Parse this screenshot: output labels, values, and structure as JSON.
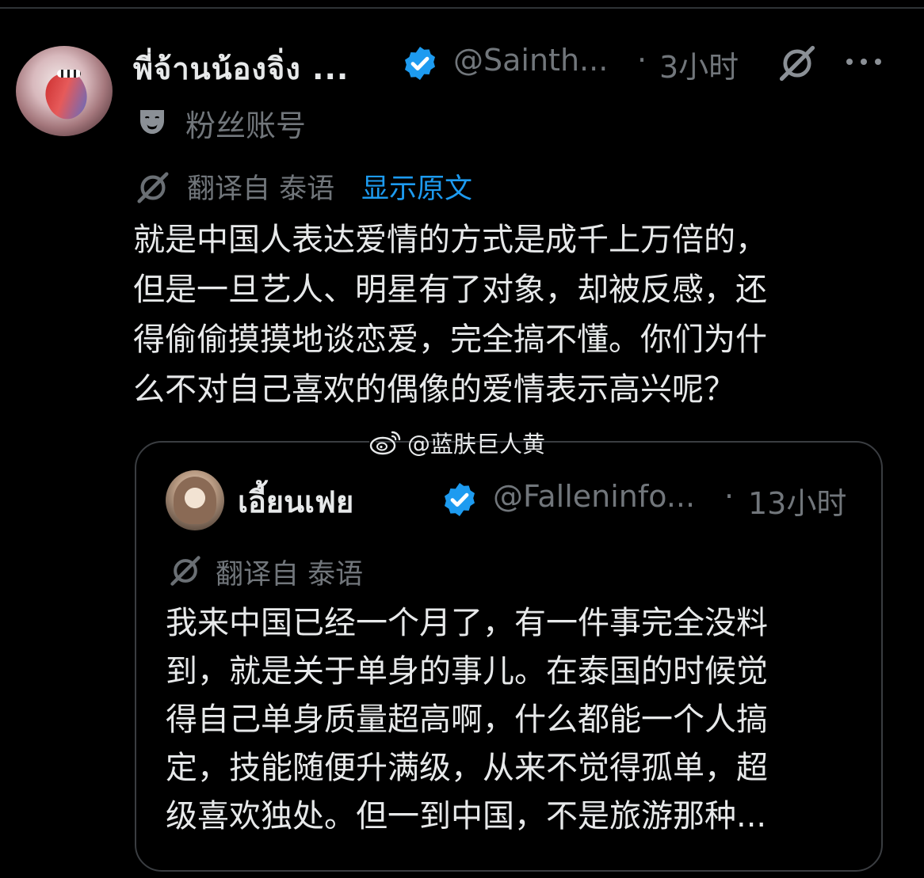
{
  "tweet": {
    "display_name": "พี่จ้านน้องจิ่ง ...",
    "handle": "@Sainth...",
    "separator": "·",
    "time": "3小时",
    "account_label": "粉丝账号",
    "translated_from": "翻译自 泰语",
    "show_original": "显示原文",
    "body": "就是中国人表达爱情的方式是成千上万倍的，\n但是一旦艺人、明星有了对象，却被反感，还\n得偷偷摸摸地谈恋爱，完全搞不懂。你们为什\n么不对自己喜欢的偶像的爱情表示高兴呢？"
  },
  "watermark": {
    "text": "@蓝肤巨人黄"
  },
  "quoted_tweet": {
    "display_name": "เอี้ยนเฟย",
    "handle": "@Falleninfo...",
    "separator": "·",
    "time": "13小时",
    "translated_from": "翻译自 泰语",
    "body": "我来中国已经一个月了，有一件事完全没料\n到，就是关于单身的事儿。在泰国的时候觉\n得自己单身质量超高啊，什么都能一个人搞\n定，技能随便升满级，从来不觉得孤单，超\n级喜欢独处。但一到中国，不是旅游那种..."
  },
  "colors": {
    "background": "#000000",
    "primary_text": "#e7e9ea",
    "secondary_text": "#71767b",
    "link": "#1d9bf0",
    "verified_badge": "#1d9bf0",
    "card_border": "#3a3d41"
  },
  "icons": {
    "verified": "verified-badge-icon",
    "grok": "grok-icon",
    "more": "more-icon",
    "fan_account": "theater-mask-icon",
    "translate": "translate-icon",
    "weibo": "weibo-icon"
  }
}
